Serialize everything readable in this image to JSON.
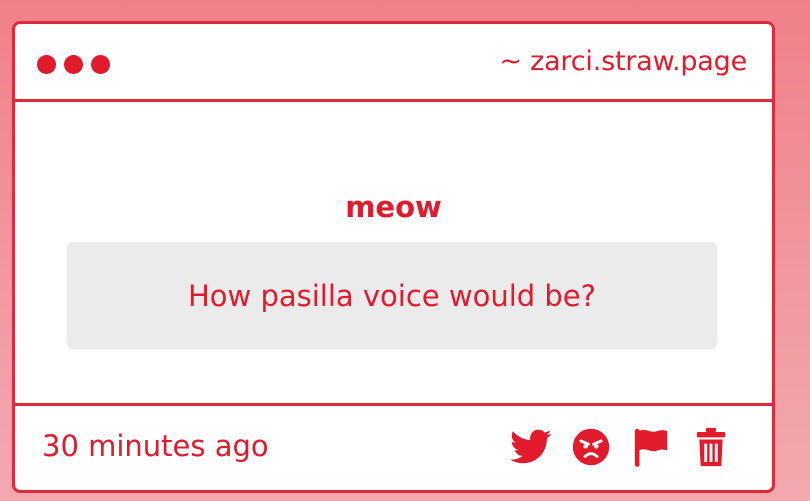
{
  "window": {
    "site": "~ zarci.straw.page"
  },
  "post": {
    "author": "meow",
    "question": "How pasilla voice would be?",
    "time": "30 minutes ago"
  },
  "actions": [
    {
      "icon": "twitter-icon"
    },
    {
      "icon": "angry-face-icon"
    },
    {
      "icon": "flag-icon"
    },
    {
      "icon": "trash-icon"
    }
  ],
  "colors": {
    "accent": "#e11a2c",
    "border": "#e02a3a",
    "question_bg": "#ecebec",
    "background_top": "#ef8089",
    "background_bottom": "#f2a9af"
  }
}
